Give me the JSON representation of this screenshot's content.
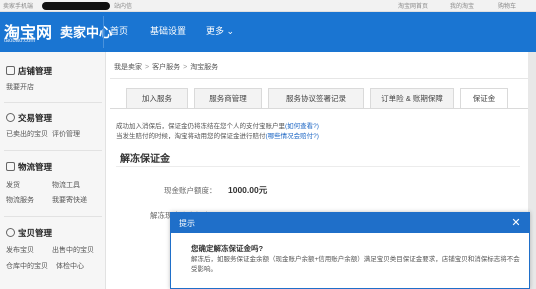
{
  "topbar": {
    "left_link": "卖家手机端",
    "left_mid_link": "站内信",
    "right_links": [
      "淘宝网首页",
      "我的淘宝",
      "购物车"
    ]
  },
  "header": {
    "logo_text": "淘宝网",
    "logo_sub": "taobao.com",
    "seller_center": "卖家中心",
    "nav": [
      "首页",
      "基础设置",
      "更多 ⌄"
    ]
  },
  "sidebar": {
    "sections": [
      {
        "title": "店铺管理",
        "links": [
          "我要开店"
        ]
      },
      {
        "title": "交易管理",
        "links": [
          "已卖出的宝贝",
          "评价管理"
        ]
      },
      {
        "title": "物流管理",
        "links": [
          "发货",
          "物流工具",
          "物流服务",
          "我要寄快递"
        ]
      },
      {
        "title": "宝贝管理",
        "links": [
          "发布宝贝",
          "出售中的宝贝",
          "仓库中的宝贝",
          "体检中心"
        ]
      }
    ]
  },
  "breadcrumb": [
    "我是卖家",
    "客户服务",
    "淘宝服务"
  ],
  "tabs": [
    {
      "label": "加入服务",
      "active": false
    },
    {
      "label": "服务商管理",
      "active": false
    },
    {
      "label": "服务协议签署记录",
      "active": false
    },
    {
      "label": "订单险 & 账期保障",
      "active": false
    },
    {
      "label": "保证金",
      "active": true
    }
  ],
  "notice": {
    "line1": "成功加入消保后，保证金仍将冻结在您个人的支付宝账户里",
    "line1_link": "(如何查看?)",
    "line2": "当发生赔付的时候，淘宝将动用您的保证金进行赔付",
    "line2_link": "(哪些情况会赔付?)"
  },
  "section_title": "解冻保证金",
  "balance": {
    "label": "现金账户额度：",
    "value": "1000.00元",
    "label2": "解冻现金账户额度："
  },
  "dialog": {
    "title": "提示",
    "close": "✕",
    "question": "您确定解冻保证金吗?",
    "description": "解冻后，如服务保证金余额（现金账户余额+信用账户余额）满足宝贝类目保证金要求，店铺宝贝和消保标志将不会受影响。"
  },
  "colors": {
    "brand_blue": "#1a75d2",
    "dialog_blue": "#1f6fc9"
  }
}
